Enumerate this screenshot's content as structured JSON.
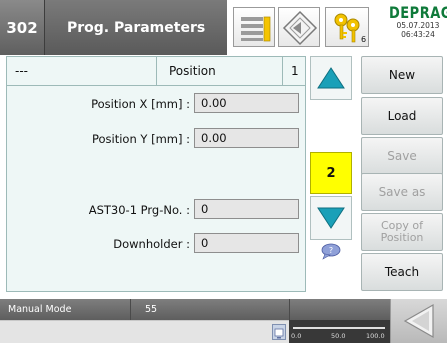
{
  "header": {
    "screen_number": "302",
    "title": "Prog. Parameters",
    "key_count": "6",
    "brand": "DEPRAG",
    "date": "05.07.2013",
    "time": "06:43:24"
  },
  "panel": {
    "head_left": "---",
    "head_middle": "Position",
    "head_right": "1",
    "fields": [
      {
        "label": "Position X [mm] :",
        "value": "0.00"
      },
      {
        "label": "Position Y [mm] :",
        "value": "0.00"
      },
      {
        "label": "AST30-1 Prg-No. :",
        "value": "0"
      },
      {
        "label": "Downholder :",
        "value": "0"
      }
    ]
  },
  "navigator": {
    "current_position": "2"
  },
  "buttons": {
    "new": "New",
    "load": "Load",
    "save": "Save",
    "save_as": "Save as",
    "copy_line1": "Copy of",
    "copy_line2": "Position",
    "teach": "Teach"
  },
  "status": {
    "mode": "Manual Mode",
    "code": "55",
    "scale_min": "0.0",
    "scale_mid": "50.0",
    "scale_max": "100.0"
  },
  "colors": {
    "accent_arrow": "#1aa0b8",
    "counter_bg": "#ffff00",
    "brand": "#0f7a3a",
    "panel_bg": "#eef7f6"
  }
}
